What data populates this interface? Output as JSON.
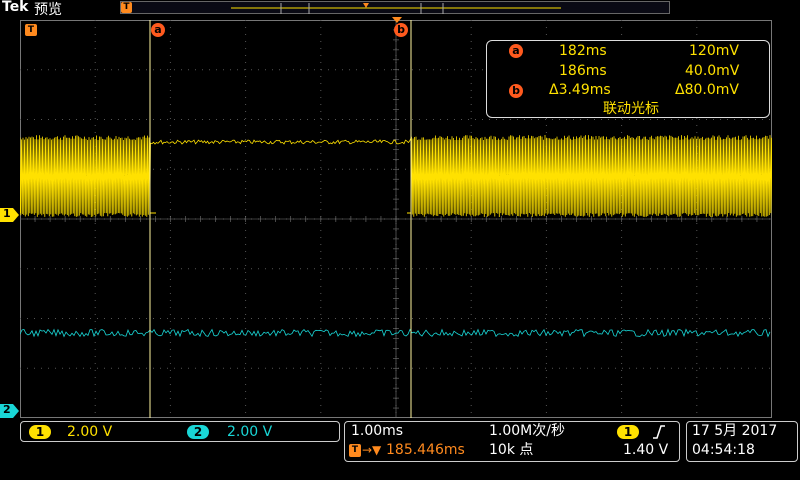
{
  "header": {
    "brand": "Tek",
    "mode": "预览"
  },
  "markers": {
    "trigger_pos": "T",
    "cursor_a": "a",
    "cursor_b": "b",
    "ch1_ref": "1",
    "ch2_ref": "2"
  },
  "cursor_readout": {
    "a_label": "a",
    "b_label": "b",
    "a_time": "182ms",
    "a_value": "120mV",
    "b_time": "186ms",
    "b_value": "40.0mV",
    "delta_time": "Δ3.49ms",
    "delta_value": "Δ80.0mV",
    "mode": "联动光标"
  },
  "channels": [
    {
      "id": "1",
      "scale": "2.00 V",
      "color": "#ffe100"
    },
    {
      "id": "2",
      "scale": "2.00 V",
      "color": "#19d6d6"
    }
  ],
  "timebase": {
    "scale": "1.00ms",
    "sample_rate": "1.00M次/秒",
    "trigger_position": "185.446ms",
    "record_length": "10k 点"
  },
  "trigger": {
    "source": "1",
    "slope": "rising",
    "level": "1.40 V"
  },
  "datetime": {
    "date": "17 5月  2017",
    "time": "04:54:18"
  }
}
